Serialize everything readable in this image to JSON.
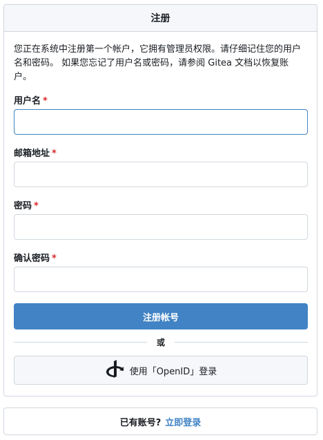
{
  "header": {
    "title": "注册"
  },
  "notice": "您正在系统中注册第一个帐户，它拥有管理员权限。请仔细记住您的用户名和密码。 如果您忘记了用户名或密码，请参阅 Gitea 文档以恢复账户。",
  "fields": [
    {
      "label": "用户名",
      "required_mark": "*",
      "value": ""
    },
    {
      "label": "邮箱地址",
      "required_mark": "*",
      "value": ""
    },
    {
      "label": "密码",
      "required_mark": "*",
      "value": ""
    },
    {
      "label": "确认密码",
      "required_mark": "*",
      "value": ""
    }
  ],
  "submit_label": "注册帐号",
  "divider_text": "或",
  "openid": {
    "label": "使用「OpenID」登录",
    "icon": "openid-icon"
  },
  "footer": {
    "text": "已有账号?",
    "link": "立即登录"
  },
  "colors": {
    "primary": "#4183c4",
    "required": "#db2828",
    "border": "#d0d7de",
    "header_bg": "#f6f7fa"
  }
}
